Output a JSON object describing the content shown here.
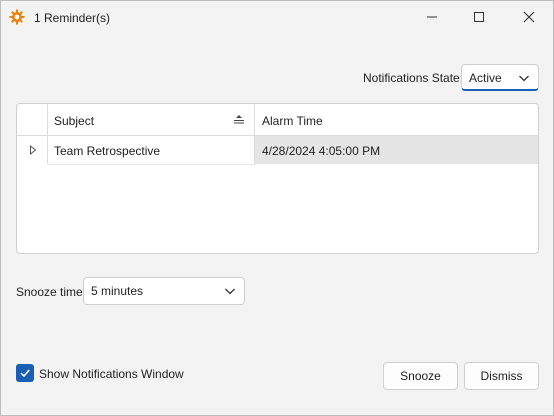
{
  "window": {
    "title": "1 Reminder(s)",
    "icon": "gear-icon",
    "accent": "#1a5fb4"
  },
  "notifications": {
    "label": "Notifications State:",
    "value": "Active"
  },
  "grid": {
    "columns": [
      "Subject",
      "Alarm Time"
    ],
    "rows": [
      {
        "subject": "Team Retrospective",
        "alarm_time": "4/28/2024 4:05:00 PM"
      }
    ]
  },
  "snooze": {
    "label": "Snooze time:",
    "value": "5 minutes"
  },
  "footer": {
    "show_window_label": "Show Notifications Window",
    "show_window_checked": true,
    "snooze_button": "Snooze",
    "dismiss_button": "Dismiss"
  }
}
